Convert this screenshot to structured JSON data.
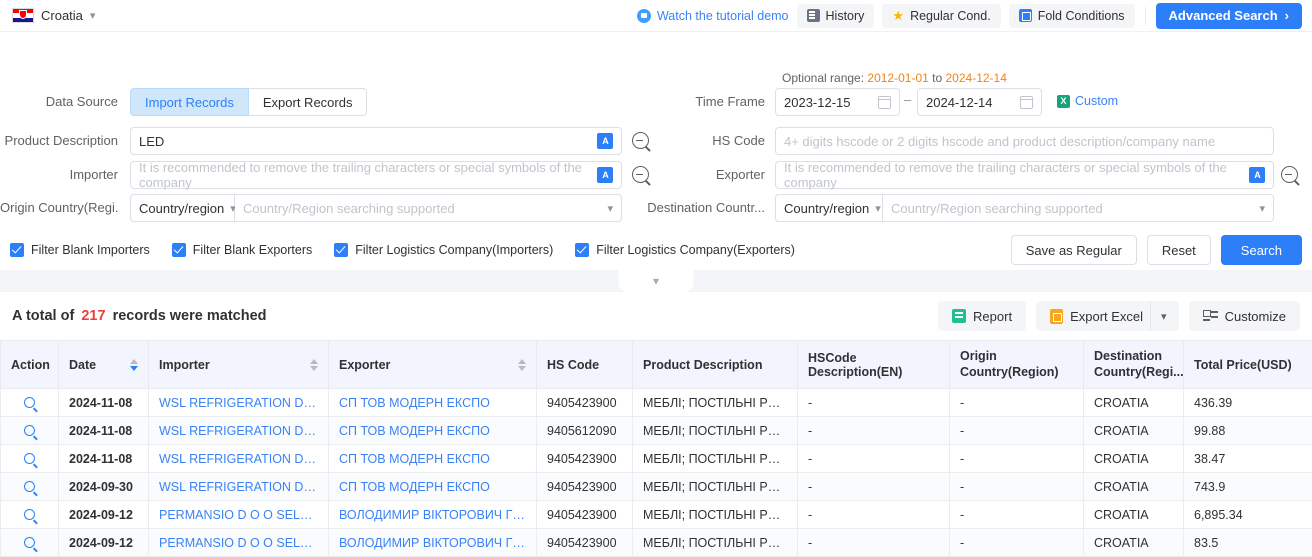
{
  "topbar": {
    "country": "Croatia",
    "tutorial_label": "Watch the tutorial demo",
    "history_label": "History",
    "regular_cond_label": "Regular Cond.",
    "fold_conditions_label": "Fold Conditions",
    "advanced_search_label": "Advanced Search"
  },
  "search": {
    "optional_range_prefix": "Optional range:",
    "optional_range_from": "2012-01-01",
    "optional_range_to_word": "to",
    "optional_range_to": "2024-12-14",
    "data_source_label": "Data Source",
    "import_records_label": "Import Records",
    "export_records_label": "Export Records",
    "time_frame_label": "Time Frame",
    "time_frame_start": "2023-12-15",
    "time_frame_sep": "–",
    "time_frame_end": "2024-12-14",
    "custom_label": "Custom",
    "product_description_label": "Product Description",
    "product_description_value": "LED",
    "hs_code_label": "HS Code",
    "hs_code_placeholder": "4+ digits hscode or 2 digits hscode and product description/company name",
    "importer_label": "Importer",
    "importer_placeholder": "It is recommended to remove the trailing characters or special symbols of the company",
    "exporter_label": "Exporter",
    "exporter_placeholder": "It is recommended to remove the trailing characters or special symbols of the company",
    "origin_country_label": "Origin Country(Regi...",
    "origin_country_select": "Country/region",
    "origin_country_placeholder": "Country/Region searching supported",
    "destination_country_label": "Destination Countr...",
    "destination_country_select": "Country/region",
    "destination_country_placeholder": "Country/Region searching supported",
    "checkboxes": [
      {
        "label": "Filter Blank Importers",
        "checked": true
      },
      {
        "label": "Filter Blank Exporters",
        "checked": true
      },
      {
        "label": "Filter Logistics Company(Importers)",
        "checked": true
      },
      {
        "label": "Filter Logistics Company(Exporters)",
        "checked": true
      }
    ],
    "save_as_regular_label": "Save as Regular",
    "reset_label": "Reset",
    "search_label": "Search"
  },
  "results": {
    "total_prefix": "A total of",
    "total_count": "217",
    "total_suffix": "records were matched",
    "report_label": "Report",
    "export_excel_label": "Export Excel",
    "customize_label": "Customize"
  },
  "table": {
    "columns": [
      {
        "label": "Action",
        "sortable": false
      },
      {
        "label": "Date",
        "sortable": true,
        "sorted": "desc"
      },
      {
        "label": "Importer",
        "sortable": true
      },
      {
        "label": "Exporter",
        "sortable": true
      },
      {
        "label": "HS Code",
        "sortable": false
      },
      {
        "label": "Product Description",
        "sortable": false
      },
      {
        "label": "HSCode Description(EN)",
        "sortable": false
      },
      {
        "label": "Origin\nCountry(Region)",
        "sortable": false
      },
      {
        "label": "Destination\nCountry(Regi...",
        "sortable": false
      },
      {
        "label": "Total Price(USD)",
        "sortable": false
      }
    ],
    "rows": [
      {
        "date": "2024-11-08",
        "importer": "WSL REFRIGERATION D O O O ...",
        "exporter": "СП ТОВ МОДЕРН ЕКСПО",
        "hs_code": "9405423900",
        "product_description": "МЕБЛІ; ПОСТІЛЬНІ РЕЧІ, ...",
        "hscode_description": "-",
        "origin_country": "-",
        "destination_country": "CROATIA",
        "total_price": "436.39"
      },
      {
        "date": "2024-11-08",
        "importer": "WSL REFRIGERATION D O O O ...",
        "exporter": "СП ТОВ МОДЕРН ЕКСПО",
        "hs_code": "9405612090",
        "product_description": "МЕБЛІ; ПОСТІЛЬНІ РЕЧІ, ...",
        "hscode_description": "-",
        "origin_country": "-",
        "destination_country": "CROATIA",
        "total_price": "99.88"
      },
      {
        "date": "2024-11-08",
        "importer": "WSL REFRIGERATION D O O O ...",
        "exporter": "СП ТОВ МОДЕРН ЕКСПО",
        "hs_code": "9405423900",
        "product_description": "МЕБЛІ; ПОСТІЛЬНІ РЕЧІ, ...",
        "hscode_description": "-",
        "origin_country": "-",
        "destination_country": "CROATIA",
        "total_price": "38.47"
      },
      {
        "date": "2024-09-30",
        "importer": "WSL REFRIGERATION D O O O ...",
        "exporter": "СП ТОВ МОДЕРН ЕКСПО",
        "hs_code": "9405423900",
        "product_description": "МЕБЛІ; ПОСТІЛЬНІ РЕЧІ, ...",
        "hscode_description": "-",
        "origin_country": "-",
        "destination_country": "CROATIA",
        "total_price": "743.9"
      },
      {
        "date": "2024-09-12",
        "importer": "PERMANSIO D O O SELCINSK...",
        "exporter": "ВОЛОДИМИР ВІКТОРОВИЧ ГРОЗА ...",
        "hs_code": "9405423900",
        "product_description": "МЕБЛІ; ПОСТІЛЬНІ РЕЧІ, ...",
        "hscode_description": "-",
        "origin_country": "-",
        "destination_country": "CROATIA",
        "total_price": "6,895.34"
      },
      {
        "date": "2024-09-12",
        "importer": "PERMANSIO D O O SELCINSK...",
        "exporter": "ВОЛОДИМИР ВІКТОРОВИЧ ГРОЗА ...",
        "hs_code": "9405423900",
        "product_description": "МЕБЛІ; ПОСТІЛЬНІ РЕЧІ, ...",
        "hscode_description": "-",
        "origin_country": "-",
        "destination_country": "CROATIA",
        "total_price": "83.5"
      }
    ]
  }
}
